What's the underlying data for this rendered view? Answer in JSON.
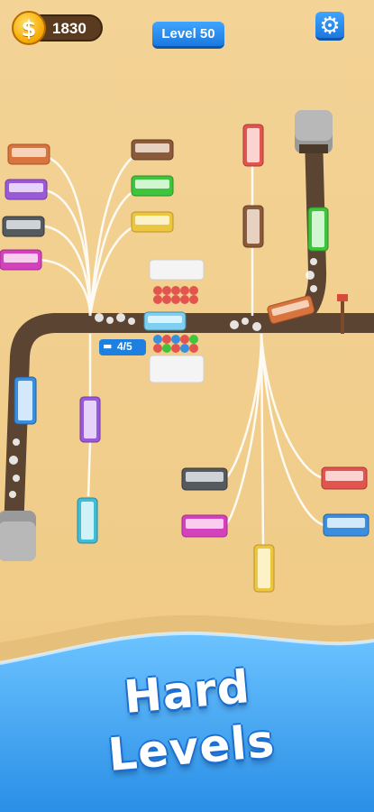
{
  "hud": {
    "coins": "1830",
    "level_label": "Level 50",
    "coin_icon": "dollar-coin-icon",
    "settings_icon": "gear-icon"
  },
  "station": {
    "capacity_label": "4/5",
    "capacity_icon": "bus-icon"
  },
  "banner": {
    "line1": "Hard",
    "line2": "Levels"
  },
  "colors": {
    "sand": "#f1cf8f",
    "road": "#5b4431",
    "sea": "#3aa6f2",
    "ui_blue": "#1c78e0",
    "coin": "#f5a700"
  },
  "buses_left": [
    {
      "color": "#d8743e",
      "name": "orange"
    },
    {
      "color": "#9b59d6",
      "name": "purple"
    },
    {
      "color": "#555a5f",
      "name": "gray"
    },
    {
      "color": "#d441bd",
      "name": "magenta"
    }
  ],
  "buses_right_top": [
    {
      "color": "#8a5a3a",
      "name": "brown"
    },
    {
      "color": "#3fc53d",
      "name": "green"
    },
    {
      "color": "#ecc640",
      "name": "yellow"
    }
  ],
  "buses_bottom": [
    {
      "color": "#555a5f",
      "name": "gray"
    },
    {
      "color": "#d441bd",
      "name": "magenta"
    },
    {
      "color": "#e2544e",
      "name": "red"
    },
    {
      "color": "#3a8ee0",
      "name": "blue"
    },
    {
      "color": "#ecc640",
      "name": "yellow"
    }
  ]
}
